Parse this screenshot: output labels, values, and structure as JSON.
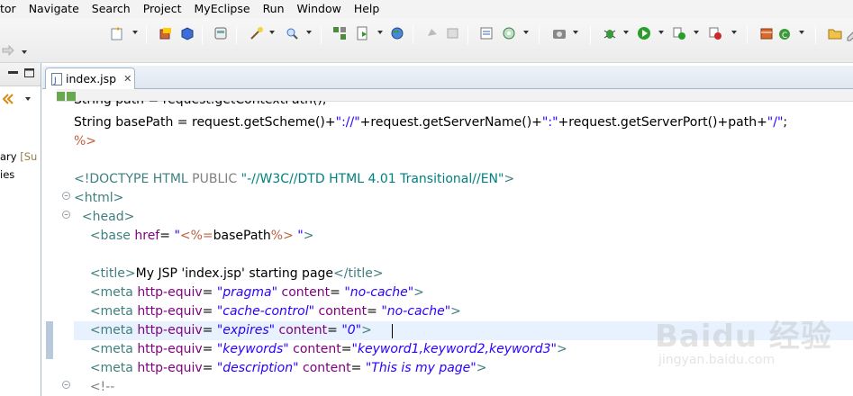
{
  "menu": [
    "tor",
    "Navigate",
    "Search",
    "Project",
    "MyEclipse",
    "Run",
    "Window",
    "Help"
  ],
  "left_panel": {
    "lines": [
      {
        "text": "ary",
        "suffix": " [Su"
      },
      {
        "text": "ies",
        "suffix": ""
      }
    ]
  },
  "editor_tab": {
    "label": "index.jsp",
    "close": "✕"
  },
  "code": {
    "line0": "String path = request.getContextPath();",
    "line1_pre": "String basePath = request.getScheme()+",
    "line1_s1": "\"://\"",
    "line1_mid1": "+request.getServerName()+",
    "line1_s2": "\":\"",
    "line1_mid2": "+request.getServerPort()+path+",
    "line1_s3": "\"/\"",
    "line1_end": ";",
    "line2": "%>",
    "doctype": "<!DOCTYPE HTML",
    "doctype_public": "PUBLIC",
    "doctype_str": "\"-//W3C//DTD HTML 4.01 Transitional//EN\"",
    "doctype_end": ">",
    "html_open": "<html>",
    "head_open": "<head>",
    "base_tag": "<base ",
    "base_attr": "href",
    "base_eq": "= ",
    "base_q1": "\"",
    "base_jsp": "<%=",
    "base_expr": "basePath",
    "base_jsp_end": "%>",
    "base_q2": " \"",
    "base_close": ">",
    "title_open": "<title>",
    "title_text": "My JSP 'index.jsp' starting page",
    "title_close": "</title>",
    "meta_tag": "<meta ",
    "meta_he": "http-equiv",
    "meta_content": "content",
    "meta_name_content": "content",
    "eq": "= ",
    "eq2": "=",
    "m1_v1": "\"pragma\"",
    "m1_v2": "\"no-cache\"",
    "m2_v1": "\"cache-control\"",
    "m2_v2": "\"no-cache\"",
    "m3_v1": "\"expires\"",
    "m3_v2": "\"0\"",
    "m4_v1": "\"keywords\"",
    "m4_v2": "\"keyword1,keyword2,keyword3\"",
    "m5_v1": "\"description\"",
    "m5_v2": "\"This is my page\"",
    "gt": ">",
    "comment_open": "<!--"
  },
  "watermark": {
    "logo": "Baidu 经验",
    "url": "jingyan.baidu.com"
  },
  "colors": {
    "tag": "#3f7f7f",
    "attr": "#7f007f",
    "value": "#2a00ff",
    "jsp": "#bf5f3f",
    "current_line": "#e8f2fe"
  }
}
